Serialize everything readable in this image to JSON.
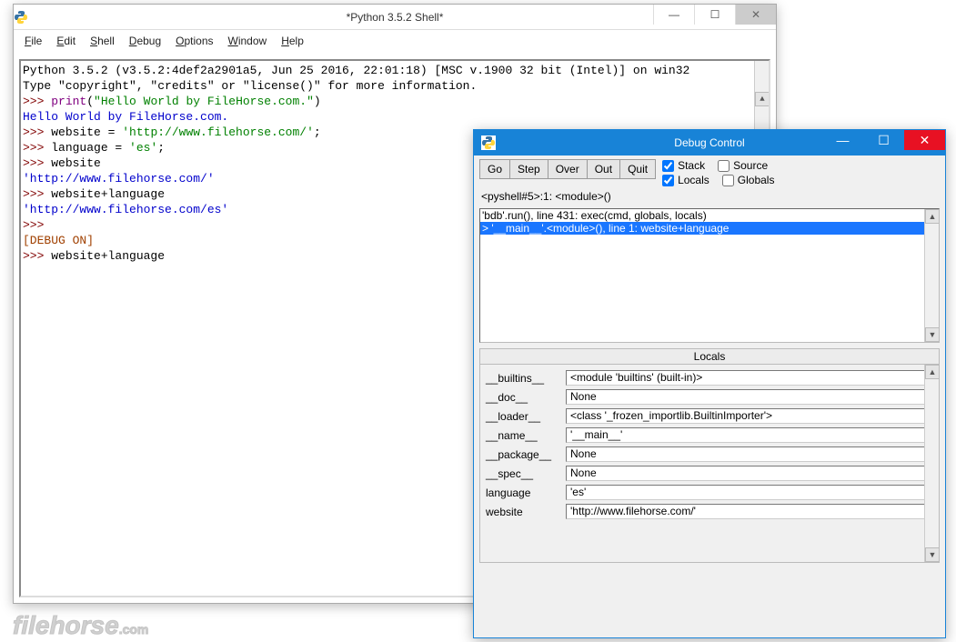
{
  "shell": {
    "title": "*Python 3.5.2 Shell*",
    "menus": {
      "file": "File",
      "edit": "Edit",
      "shell": "Shell",
      "debug": "Debug",
      "options": "Options",
      "window": "Window",
      "help": "Help"
    },
    "lines": [
      {
        "segs": [
          {
            "t": "Python 3.5.2 (v3.5.2:4def2a2901a5, Jun 25 2016, 22:01:18) [MSC v.1900 32 bit (Intel)] on win32",
            "c": ""
          }
        ]
      },
      {
        "segs": [
          {
            "t": "Type \"copyright\", \"credits\" or \"license()\" for more information.",
            "c": ""
          }
        ]
      },
      {
        "segs": [
          {
            "t": ">>> ",
            "c": "prompt"
          },
          {
            "t": "print",
            "c": "kw"
          },
          {
            "t": "(",
            "c": ""
          },
          {
            "t": "\"Hello World by FileHorse.com.\"",
            "c": "str"
          },
          {
            "t": ")",
            "c": ""
          }
        ]
      },
      {
        "segs": [
          {
            "t": "Hello World by FileHorse.com.",
            "c": "out-blue"
          }
        ]
      },
      {
        "segs": [
          {
            "t": ">>> ",
            "c": "prompt"
          },
          {
            "t": "website = ",
            "c": ""
          },
          {
            "t": "'http://www.filehorse.com/'",
            "c": "str"
          },
          {
            "t": ";",
            "c": ""
          }
        ]
      },
      {
        "segs": [
          {
            "t": ">>> ",
            "c": "prompt"
          },
          {
            "t": "language = ",
            "c": ""
          },
          {
            "t": "'es'",
            "c": "str"
          },
          {
            "t": ";",
            "c": ""
          }
        ]
      },
      {
        "segs": [
          {
            "t": ">>> ",
            "c": "prompt"
          },
          {
            "t": "website",
            "c": ""
          }
        ]
      },
      {
        "segs": [
          {
            "t": "'http://www.filehorse.com/'",
            "c": "out-blue"
          }
        ]
      },
      {
        "segs": [
          {
            "t": ">>> ",
            "c": "prompt"
          },
          {
            "t": "website+language",
            "c": ""
          }
        ]
      },
      {
        "segs": [
          {
            "t": "'http://www.filehorse.com/es'",
            "c": "out-blue"
          }
        ]
      },
      {
        "segs": [
          {
            "t": ">>>",
            "c": "prompt"
          }
        ]
      },
      {
        "segs": [
          {
            "t": "[DEBUG ON]",
            "c": "debug-on"
          }
        ]
      },
      {
        "segs": [
          {
            "t": ">>> ",
            "c": "prompt"
          },
          {
            "t": "website+language",
            "c": ""
          }
        ]
      }
    ]
  },
  "debug": {
    "title": "Debug Control",
    "buttons": {
      "go": "Go",
      "step": "Step",
      "over": "Over",
      "out": "Out",
      "quit": "Quit"
    },
    "checks": {
      "stack": {
        "label": "Stack",
        "checked": true
      },
      "source": {
        "label": "Source",
        "checked": false
      },
      "locals": {
        "label": "Locals",
        "checked": true
      },
      "globals": {
        "label": "Globals",
        "checked": false
      }
    },
    "breadcrumb": "<pyshell#5>:1: <module>()",
    "stack": [
      {
        "text": "'bdb'.run(), line 431: exec(cmd, globals, locals)",
        "selected": false
      },
      {
        "text": "> '__main__'.<module>(), line 1: website+language",
        "selected": true
      }
    ],
    "locals_header": "Locals",
    "locals": [
      {
        "key": "__builtins__",
        "val": "<module 'builtins' (built-in)>"
      },
      {
        "key": "__doc__",
        "val": "None"
      },
      {
        "key": "__loader__",
        "val": "<class '_frozen_importlib.BuiltinImporter'>"
      },
      {
        "key": "__name__",
        "val": "'__main__'"
      },
      {
        "key": "__package__",
        "val": "None"
      },
      {
        "key": "__spec__",
        "val": "None"
      },
      {
        "key": "language",
        "val": "'es'"
      },
      {
        "key": "website",
        "val": "'http://www.filehorse.com/'"
      }
    ]
  },
  "watermark": {
    "brand": "filehorse",
    "tld": ".com"
  }
}
